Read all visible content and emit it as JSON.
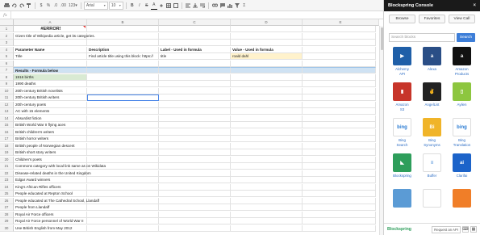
{
  "toolbar": {
    "zoom": "123",
    "percent": "%",
    "decimal_dec": ".0",
    "decimal_inc": ".00",
    "font": "Arial",
    "font_size": "10",
    "bold": "B",
    "italic": "I",
    "strike": "S",
    "text_color": "A"
  },
  "formula_bar": {
    "fx": "fx"
  },
  "columns": [
    "A",
    "B",
    "C",
    "D",
    "E"
  ],
  "rows": [
    {
      "n": "1",
      "A": "#ERROR!",
      "B": "",
      "C": "",
      "D": "",
      "E": ""
    },
    {
      "n": "2",
      "A": "Given title of Wikipedia article, get its categories.",
      "B": "",
      "C": "",
      "D": "",
      "E": ""
    },
    {
      "n": "3",
      "A": "",
      "B": "",
      "C": "",
      "D": "",
      "E": ""
    },
    {
      "n": "4",
      "A": "Parameter Name",
      "B": "Description",
      "C": "Label - Used in formula",
      "D": "Value - Used in formula",
      "E": ""
    },
    {
      "n": "5",
      "A": "Title",
      "B": "Find article title using this block: https://",
      "C": "title",
      "D": "roald dahl",
      "E": ""
    },
    {
      "n": "6",
      "A": "",
      "B": "",
      "C": "",
      "D": "",
      "E": ""
    },
    {
      "n": "7",
      "A": "Results - Formula below",
      "B": "",
      "C": "",
      "D": "",
      "E": ""
    },
    {
      "n": "8",
      "A": "1916 births",
      "B": "",
      "C": "",
      "D": "",
      "E": ""
    },
    {
      "n": "9",
      "A": "1990 deaths",
      "B": "",
      "C": "",
      "D": "",
      "E": ""
    },
    {
      "n": "10",
      "A": "20th-century British novelists",
      "B": "",
      "C": "",
      "D": "",
      "E": ""
    },
    {
      "n": "11",
      "A": "20th-century British writers",
      "B": "",
      "C": "",
      "D": "",
      "E": ""
    },
    {
      "n": "12",
      "A": "20th-century poets",
      "B": "",
      "C": "",
      "D": "",
      "E": ""
    },
    {
      "n": "13",
      "A": "AC with 15 elements",
      "B": "",
      "C": "",
      "D": "",
      "E": ""
    },
    {
      "n": "14",
      "A": "Absurdist fiction",
      "B": "",
      "C": "",
      "D": "",
      "E": ""
    },
    {
      "n": "15",
      "A": "British World War II flying aces",
      "B": "",
      "C": "",
      "D": "",
      "E": ""
    },
    {
      "n": "16",
      "A": "British children's writers",
      "B": "",
      "C": "",
      "D": "",
      "E": ""
    },
    {
      "n": "17",
      "A": "British horror writers",
      "B": "",
      "C": "",
      "D": "",
      "E": ""
    },
    {
      "n": "18",
      "A": "British people of Norwegian descent",
      "B": "",
      "C": "",
      "D": "",
      "E": ""
    },
    {
      "n": "19",
      "A": "British short story writers",
      "B": "",
      "C": "",
      "D": "",
      "E": ""
    },
    {
      "n": "20",
      "A": "Children's poets",
      "B": "",
      "C": "",
      "D": "",
      "E": ""
    },
    {
      "n": "21",
      "A": "Commons category with local link same as on Wikidata",
      "B": "",
      "C": "",
      "D": "",
      "E": ""
    },
    {
      "n": "22",
      "A": "Disease-related deaths in the United Kingdom",
      "B": "",
      "C": "",
      "D": "",
      "E": ""
    },
    {
      "n": "23",
      "A": "Edgar Award winners",
      "B": "",
      "C": "",
      "D": "",
      "E": ""
    },
    {
      "n": "24",
      "A": "King's African Rifles officers",
      "B": "",
      "C": "",
      "D": "",
      "E": ""
    },
    {
      "n": "25",
      "A": "People educated at Repton School",
      "B": "",
      "C": "",
      "D": "",
      "E": ""
    },
    {
      "n": "26",
      "A": "People educated at The Cathedral School, Llandaff",
      "B": "",
      "C": "",
      "D": "",
      "E": ""
    },
    {
      "n": "27",
      "A": "People from Llandaff",
      "B": "",
      "C": "",
      "D": "",
      "E": ""
    },
    {
      "n": "28",
      "A": "Royal Air Force officers",
      "B": "",
      "C": "",
      "D": "",
      "E": ""
    },
    {
      "n": "29",
      "A": "Royal Air Force personnel of World War II",
      "B": "",
      "C": "",
      "D": "",
      "E": ""
    },
    {
      "n": "30",
      "A": "Use British English from May 2012",
      "B": "",
      "C": "",
      "D": "",
      "E": ""
    }
  ],
  "sidebar": {
    "title": "Blockspring Console",
    "close": "×",
    "tabs": [
      "Browse",
      "Favorites",
      "View Call"
    ],
    "search_placeholder": "Search blocks",
    "search_button": "Search",
    "tiles": [
      {
        "name": "Alchemy API",
        "line1": "Alchemy",
        "line2": "API",
        "logo": "▶",
        "color": "#1f5fa8"
      },
      {
        "name": "Alexa",
        "line1": "Alexa",
        "line2": "",
        "logo": "a",
        "color": "#2a4e86"
      },
      {
        "name": "Amazon Products",
        "line1": "Amazon",
        "line2": "Products",
        "logo": "a",
        "color": "#111111"
      },
      {
        "name": "Amazon S3",
        "line1": "Amazon",
        "line2": "S3",
        "logo": "▮",
        "color": "#c7352a"
      },
      {
        "name": "AngelList",
        "line1": "AngelList",
        "line2": "",
        "logo": "✌",
        "color": "#222222"
      },
      {
        "name": "Aylien",
        "line1": "Aylien",
        "line2": "",
        "logo": "▯",
        "color": "#8dc63f"
      },
      {
        "name": "Bing Search",
        "line1": "Bing",
        "line2": "Search",
        "logo": "bing",
        "color": "#ffffff"
      },
      {
        "name": "Bing Synonyms",
        "line1": "Bing",
        "line2": "Synonyms",
        "logo": "Bi",
        "color": "#f0b429"
      },
      {
        "name": "Bing Translation",
        "line1": "Bing",
        "line2": "Translation",
        "logo": "bing",
        "color": "#ffffff"
      },
      {
        "name": "Blockspring",
        "line1": "Blockspring",
        "line2": "",
        "logo": "◣",
        "color": "#2e9e5b"
      },
      {
        "name": "Buffer",
        "line1": "Buffer",
        "line2": "",
        "logo": "≡",
        "color": "#ffffff"
      },
      {
        "name": "Clarifai",
        "line1": "Clarifai",
        "line2": "",
        "logo": "ai",
        "color": "#1c63c9"
      },
      {
        "name": "",
        "line1": "",
        "line2": "",
        "logo": "",
        "color": "#5b9bd5"
      },
      {
        "name": "",
        "line1": "",
        "line2": "",
        "logo": "",
        "color": "#ffffff"
      },
      {
        "name": "",
        "line1": "",
        "line2": "",
        "logo": "",
        "color": "#f07e28"
      }
    ],
    "footer_brand": "Blockspring",
    "footer_request": "Request an API"
  }
}
